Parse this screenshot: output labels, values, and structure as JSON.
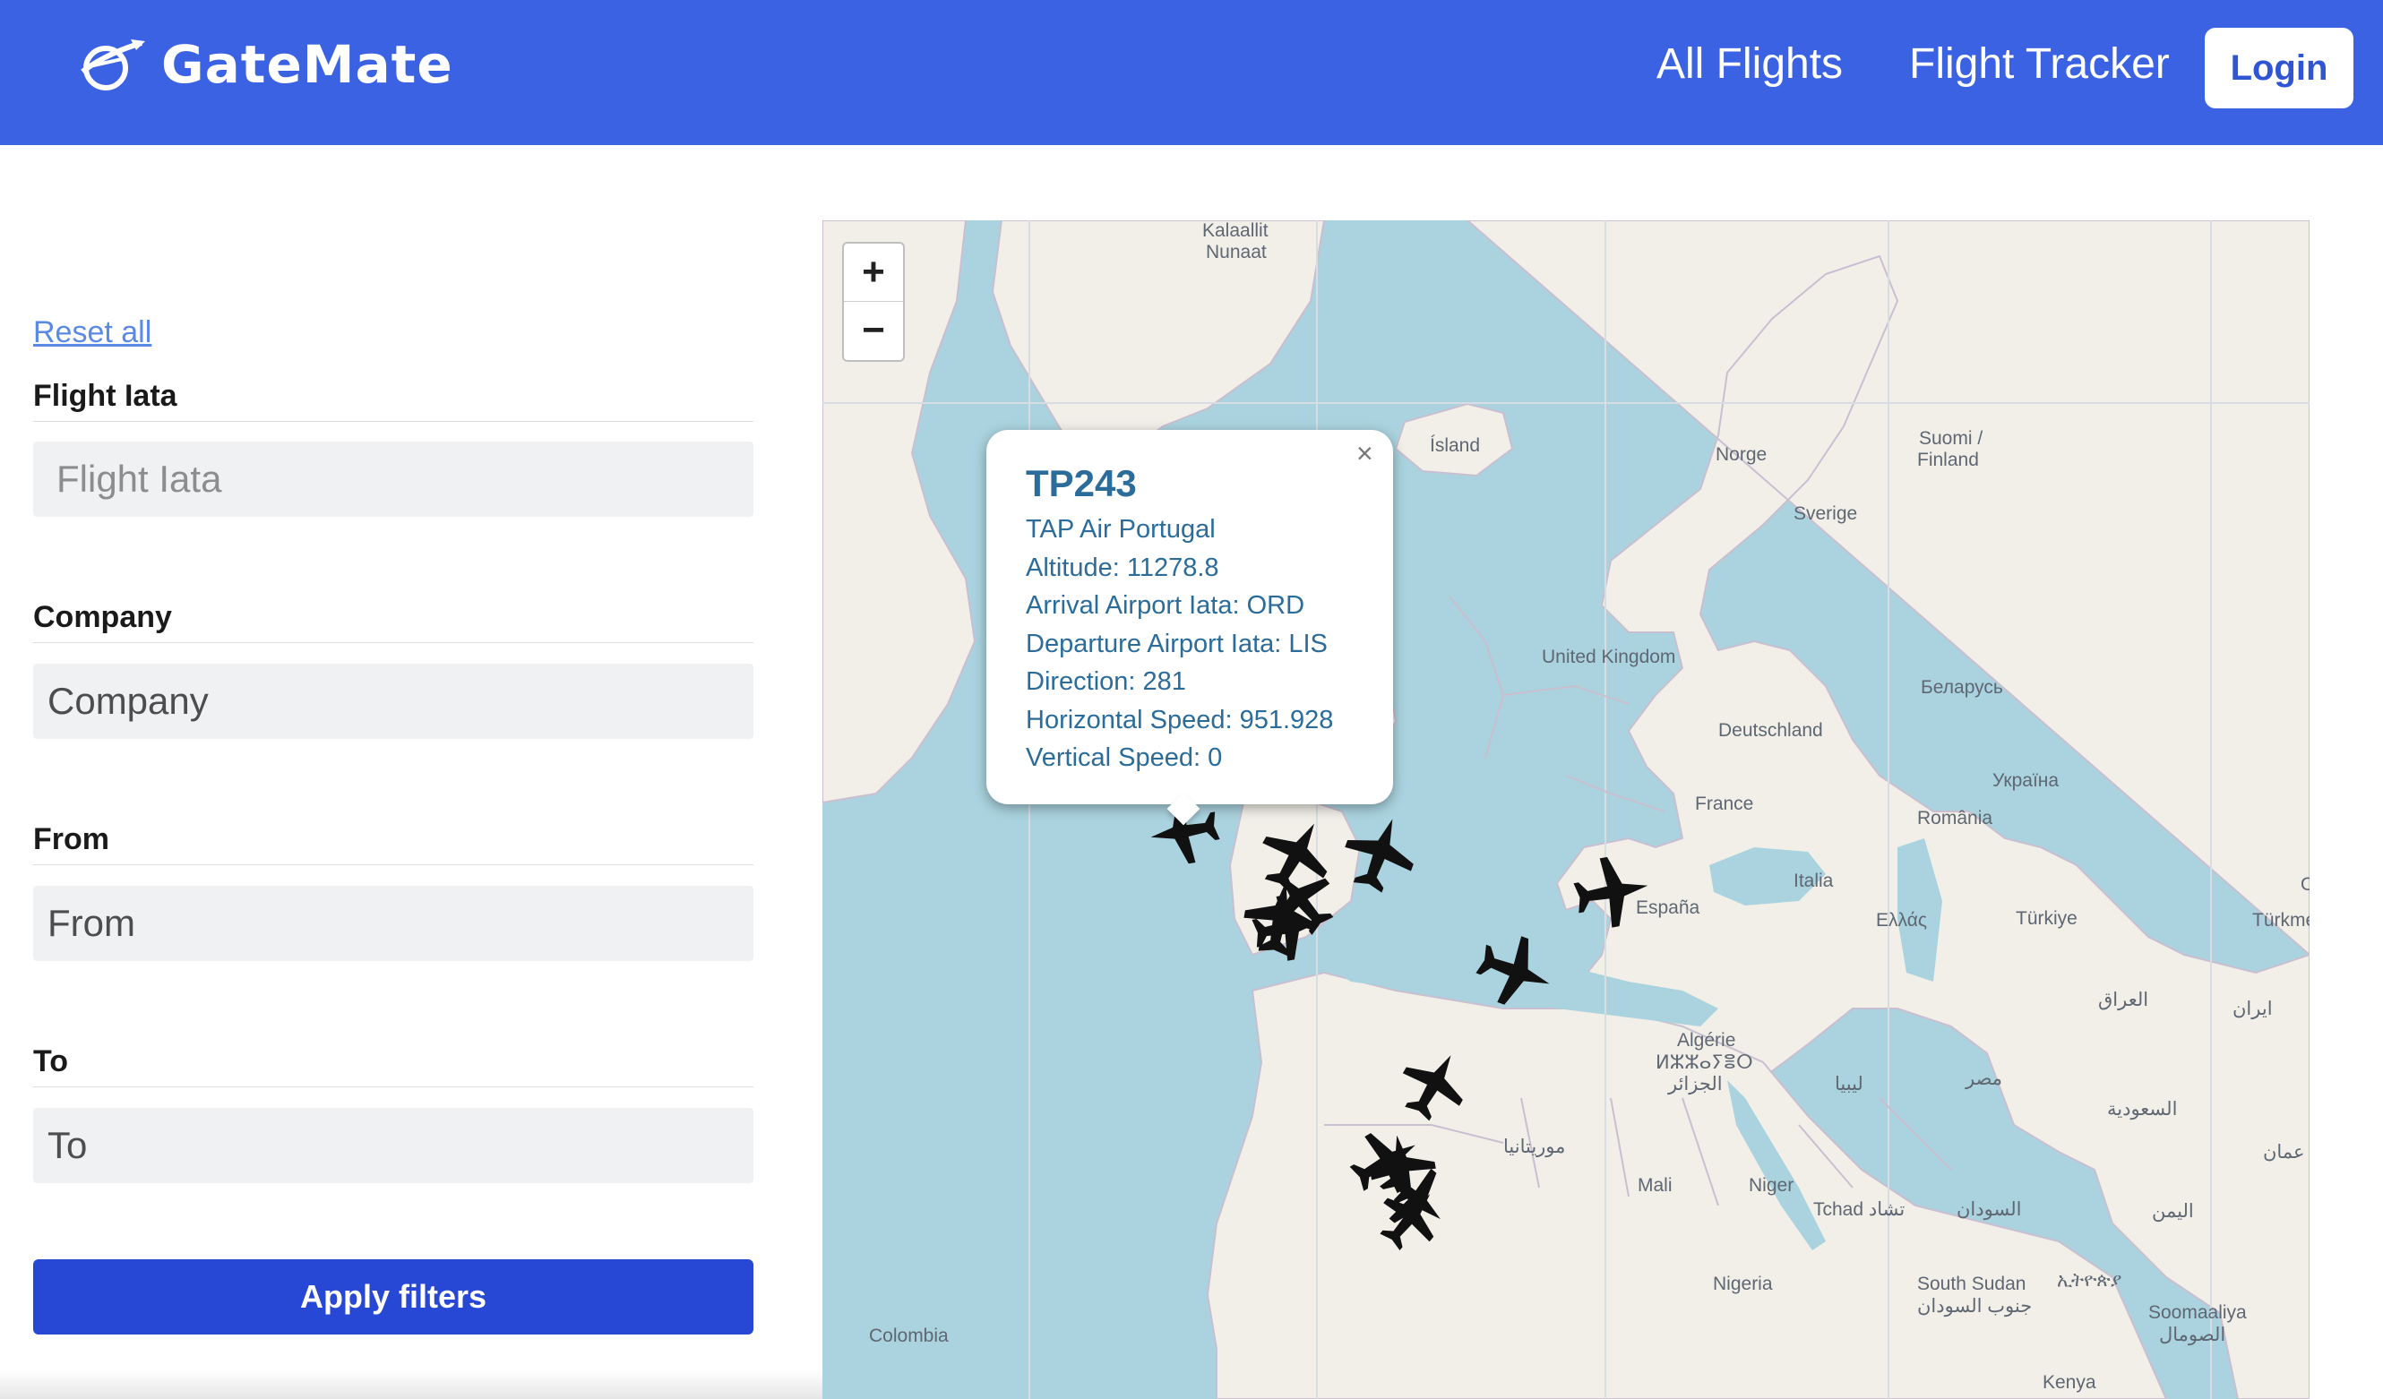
{
  "brand": {
    "name": "GateMate",
    "logo_icon": "plane-globe-icon"
  },
  "nav": {
    "all_flights": "All Flights",
    "flight_tracker": "Flight Tracker",
    "login": "Login"
  },
  "filters": {
    "reset_label": "Reset all",
    "flight_iata": {
      "label": "Flight Iata",
      "placeholder": "Flight Iata"
    },
    "company": {
      "label": "Company",
      "placeholder": "Company"
    },
    "from": {
      "label": "From",
      "placeholder": "From"
    },
    "to": {
      "label": "To",
      "placeholder": "To"
    },
    "apply_label": "Apply filters"
  },
  "map": {
    "zoom_in": "+",
    "zoom_out": "−",
    "popup": {
      "title": "TP243",
      "airline": "TAP Air Portugal",
      "altitude": "Altitude: 11278.8",
      "arrival": "Arrival Airport Iata: ORD",
      "departure": "Departure Airport Iata: LIS",
      "direction": "Direction: 281",
      "horizontal_speed": "Horizontal Speed: 951.928",
      "vertical_speed": "Vertical Speed: 0",
      "close": "×"
    },
    "labels": {
      "kalaallit": "Kalaallit",
      "nunaat": "Nunaat",
      "island": "Ísland",
      "norge": "Norge",
      "suomi": "Suomi /",
      "finland": "Finland",
      "sverige": "Sverige",
      "uk": "United Kingdom",
      "belarus": "Беларусь",
      "deutschland": "Deutschland",
      "france": "France",
      "ukraina": "Україна",
      "romania": "România",
      "italia": "Italia",
      "espana": "España",
      "ellas": "Ελλάς",
      "turkiye": "Türkiye",
      "turkmen": "Türkme",
      "iraq": "العراق",
      "iran": "ایران",
      "algerie": "Algérie",
      "algerie_tif": "ⵍⵣⵣⴰⵢⴻⵔ",
      "algerie_ar": "الجزائر",
      "libya": "ليبيا",
      "egypt": "مصر",
      "saudi": "السعودية",
      "oman": "عمان",
      "mauritania": "موريتانيا",
      "mali": "Mali",
      "niger": "Niger",
      "chad": "Tchad تشاد",
      "sudan": "السودان",
      "yemen": "اليمن",
      "nigeria": "Nigeria",
      "south_sudan": "South Sudan",
      "ethiopia": "ኢትዮጵያ",
      "south_sudan_ar": "جنوب السودان",
      "somalia": "Soomaaliya",
      "somalia_ar": "الصومال",
      "colombia": "Colombia",
      "kenya": "Kenya",
      "o_edge": "O"
    }
  },
  "colors": {
    "brand_blue": "#3a62e2",
    "apply_blue": "#2748d4",
    "popup_text": "#2b6c9b",
    "sea": "#aad3df",
    "land": "#f2efe9"
  }
}
